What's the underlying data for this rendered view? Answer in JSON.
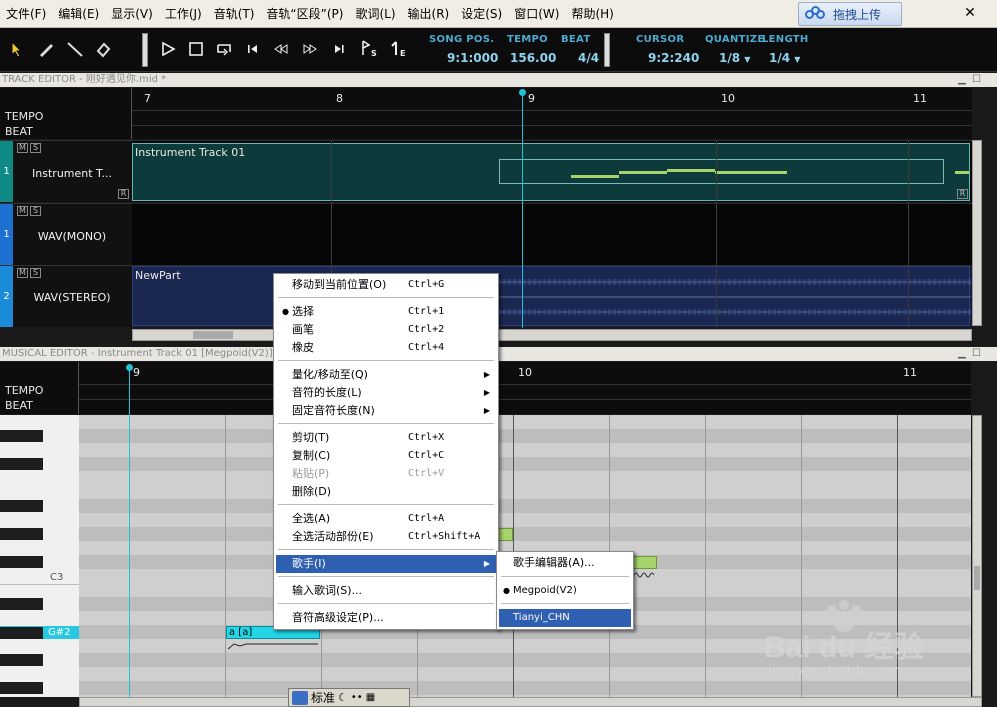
{
  "menubar": {
    "items": [
      "文件(F)",
      "编辑(E)",
      "显示(V)",
      "工作(J)",
      "音轨(T)",
      "音轨“区段”(P)",
      "歌词(L)",
      "输出(R)",
      "设定(S)",
      "窗口(W)",
      "帮助(H)"
    ],
    "upload_label": "拖拽上传"
  },
  "toolbar": {
    "song_pos_label": "SONG POS.",
    "song_pos": "9:1:000",
    "tempo_label": "TEMPO",
    "tempo": "156.00",
    "beat_label": "BEAT",
    "beat": "4/4",
    "cursor_label": "CURSOR",
    "cursor": "9:2:240",
    "quantize_label": "QUANTIZE",
    "quantize": "1/8",
    "length_label": "LENGTH",
    "length": "1/4",
    "sub_s": "S",
    "sub_e": "E"
  },
  "track_editor": {
    "title": "TRACK EDITOR - 刚好遇见你.mid *",
    "tempo_label": "TEMPO",
    "beat_label": "BEAT",
    "measures": [
      "7",
      "8",
      "9",
      "10",
      "11"
    ],
    "tracks": [
      {
        "index": "1",
        "name": "Instrument T...",
        "part": "Instrument Track 01",
        "badge": "R"
      },
      {
        "index": "1",
        "name": "WAV(MONO)",
        "part": "",
        "badge": ""
      },
      {
        "index": "2",
        "name": "WAV(STEREO)",
        "part": "NewPart",
        "badge": ""
      }
    ],
    "mute": "M",
    "solo": "S"
  },
  "musical_editor": {
    "title": "MUSICAL EDITOR - Instrument Track 01 [Megpoid(V2)]",
    "tempo_label": "TEMPO",
    "beat_label": "BEAT",
    "measures": [
      "9",
      "10",
      "11"
    ],
    "key_c3": "C3",
    "key_gs2": "G#2",
    "note_label": "a [a]"
  },
  "context_menu": {
    "items": [
      {
        "label": "移动到当前位置(O)",
        "shortcut": "Ctrl+G"
      },
      {
        "label": "选择",
        "shortcut": "Ctrl+1",
        "checked": true
      },
      {
        "label": "画笔",
        "shortcut": "Ctrl+2"
      },
      {
        "label": "橡皮",
        "shortcut": "Ctrl+4"
      },
      {
        "label": "量化/移动至(Q)",
        "submenu": true
      },
      {
        "label": "音符的长度(L)",
        "submenu": true
      },
      {
        "label": "固定音符长度(N)",
        "submenu": true
      },
      {
        "label": "剪切(T)",
        "shortcut": "Ctrl+X"
      },
      {
        "label": "复制(C)",
        "shortcut": "Ctrl+C"
      },
      {
        "label": "粘贴(P)",
        "shortcut": "Ctrl+V",
        "disabled": true
      },
      {
        "label": "删除(D)",
        "shortcut": ""
      },
      {
        "label": "全选(A)",
        "shortcut": "Ctrl+A"
      },
      {
        "label": "全选活动部份(E)",
        "shortcut": "Ctrl+Shift+A"
      },
      {
        "label": "歌手(I)",
        "submenu": true,
        "selected": true
      },
      {
        "label": "输入歌词(S)..."
      },
      {
        "label": "音符高级设定(P)..."
      }
    ]
  },
  "singer_submenu": {
    "items": [
      {
        "label": "歌手编辑器(A)..."
      },
      {
        "label": "Megpoid(V2)",
        "checked": true
      },
      {
        "label": "Tianyi_CHN",
        "selected": true
      }
    ]
  },
  "ime_bar": {
    "mode": "标准"
  },
  "watermark": {
    "brand": "Bai du 经验",
    "url": "jingyan.baidu.com"
  },
  "colors": {
    "accent": "#4ea9d0",
    "track_part": "#0d3b3b",
    "wav_part": "#1a2750",
    "note": "#a7d36a",
    "menu_highlight": "#2e5fb0",
    "playhead": "#1fc2d6"
  }
}
